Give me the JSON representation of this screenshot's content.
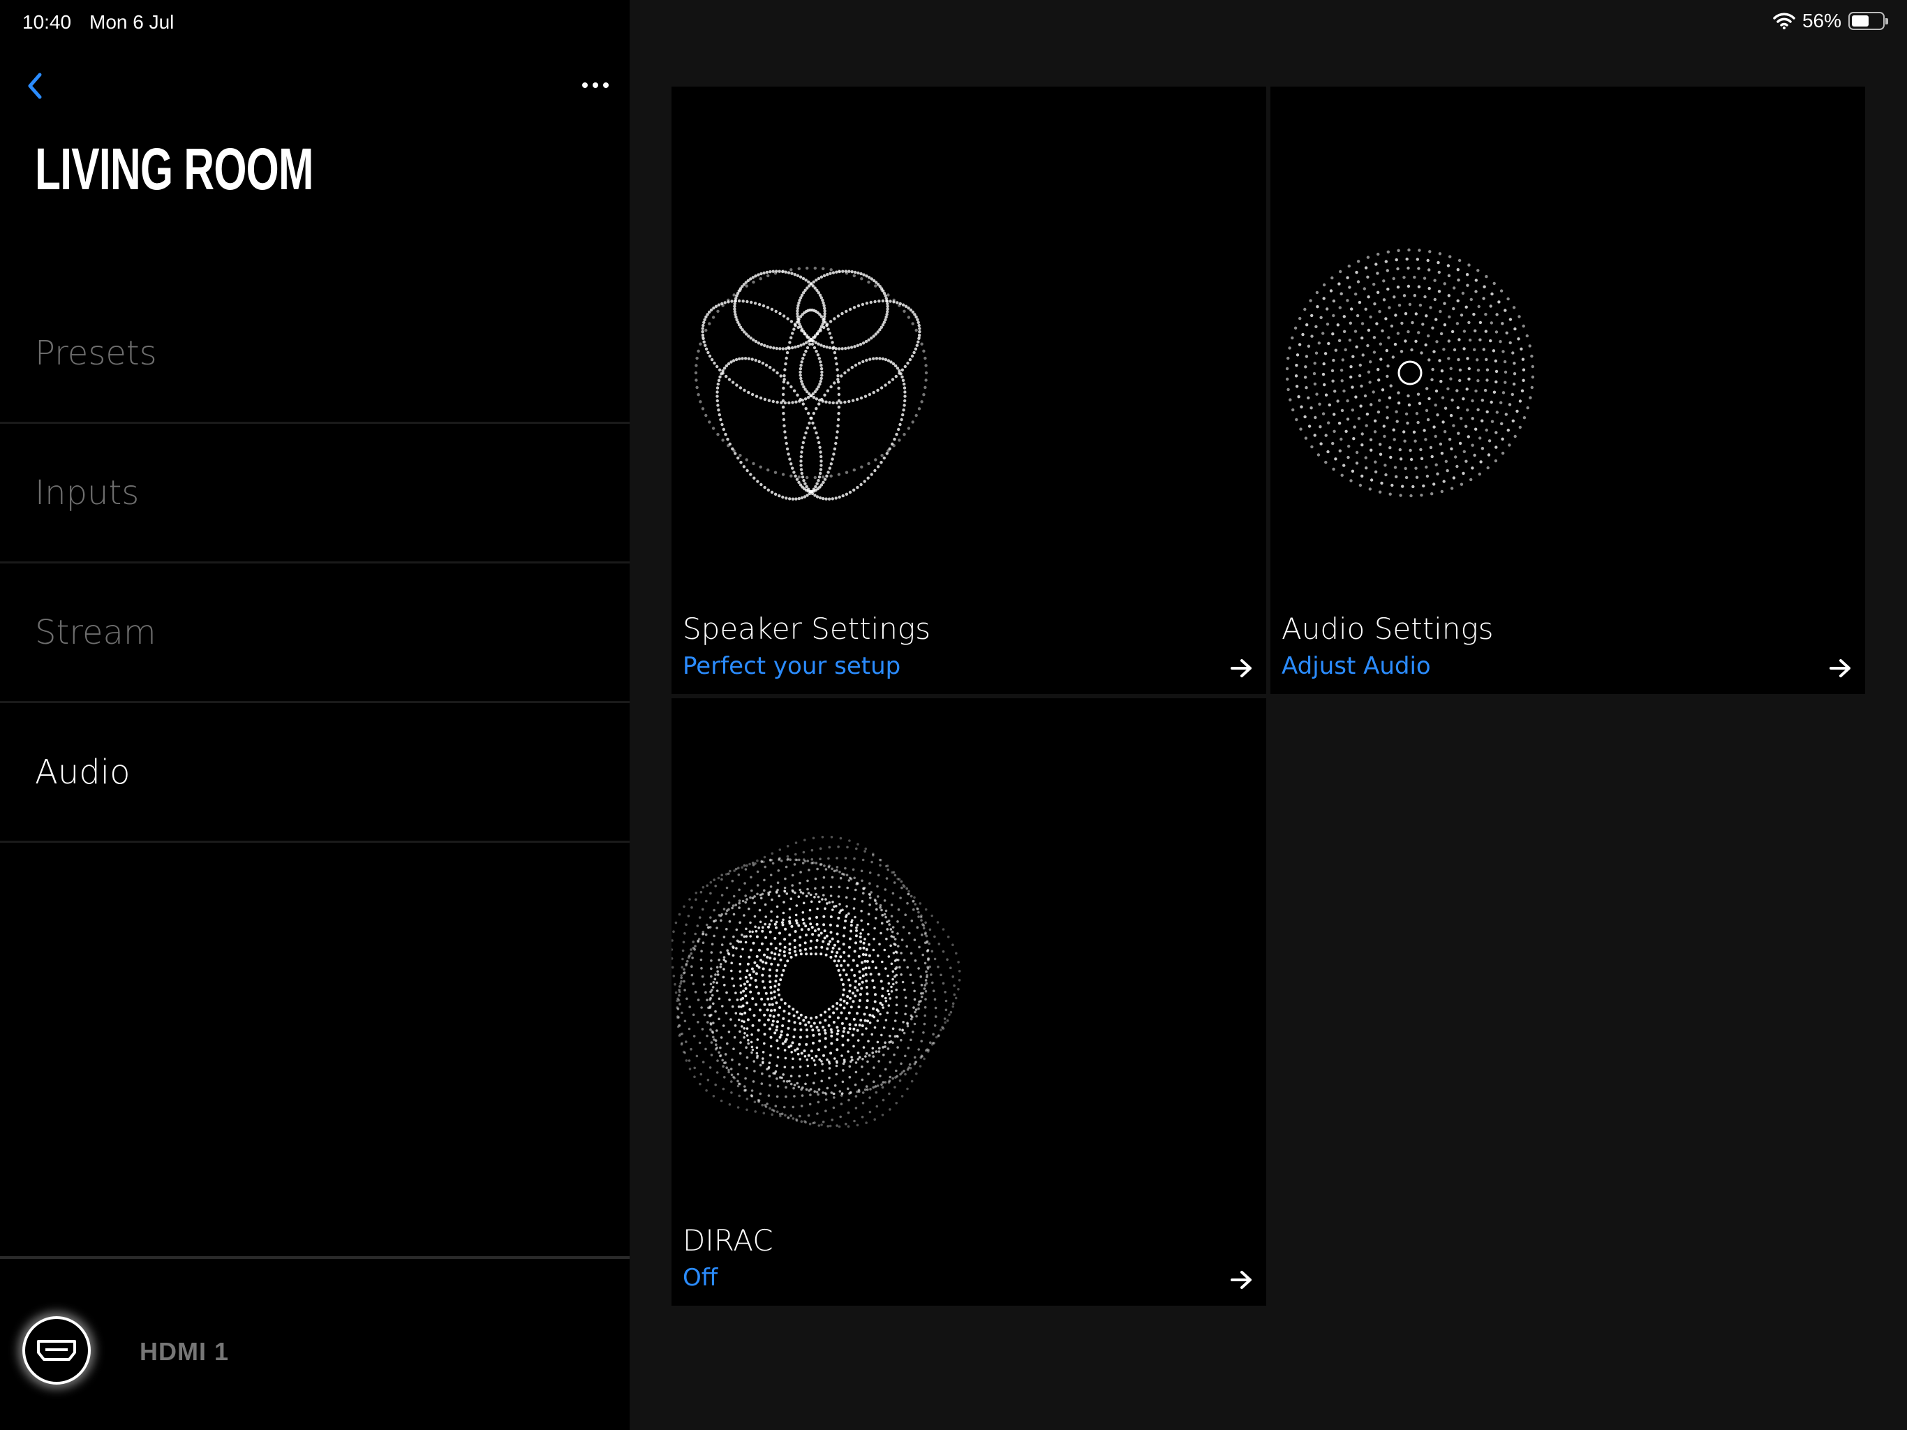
{
  "status_bar": {
    "time": "10:40",
    "date": "Mon 6 Jul",
    "battery": "56%",
    "battery_level": 0.56
  },
  "header": {
    "room_name": "LIVING ROOM"
  },
  "nav": [
    {
      "label": "Presets",
      "active": false
    },
    {
      "label": "Inputs",
      "active": false
    },
    {
      "label": "Stream",
      "active": false
    },
    {
      "label": "Audio",
      "active": true
    }
  ],
  "now_playing": {
    "source": "HDMI 1"
  },
  "cards": [
    {
      "title": "Speaker Settings",
      "subtitle": "Perfect your setup"
    },
    {
      "title": "Audio Settings",
      "subtitle": "Adjust Audio"
    },
    {
      "title": "DIRAC",
      "subtitle": "Off"
    }
  ],
  "colors": {
    "accent": "#2b8cff",
    "sidebar_bg": "#000000",
    "content_bg": "#121212",
    "inactive_text": "#6e6e6e"
  }
}
